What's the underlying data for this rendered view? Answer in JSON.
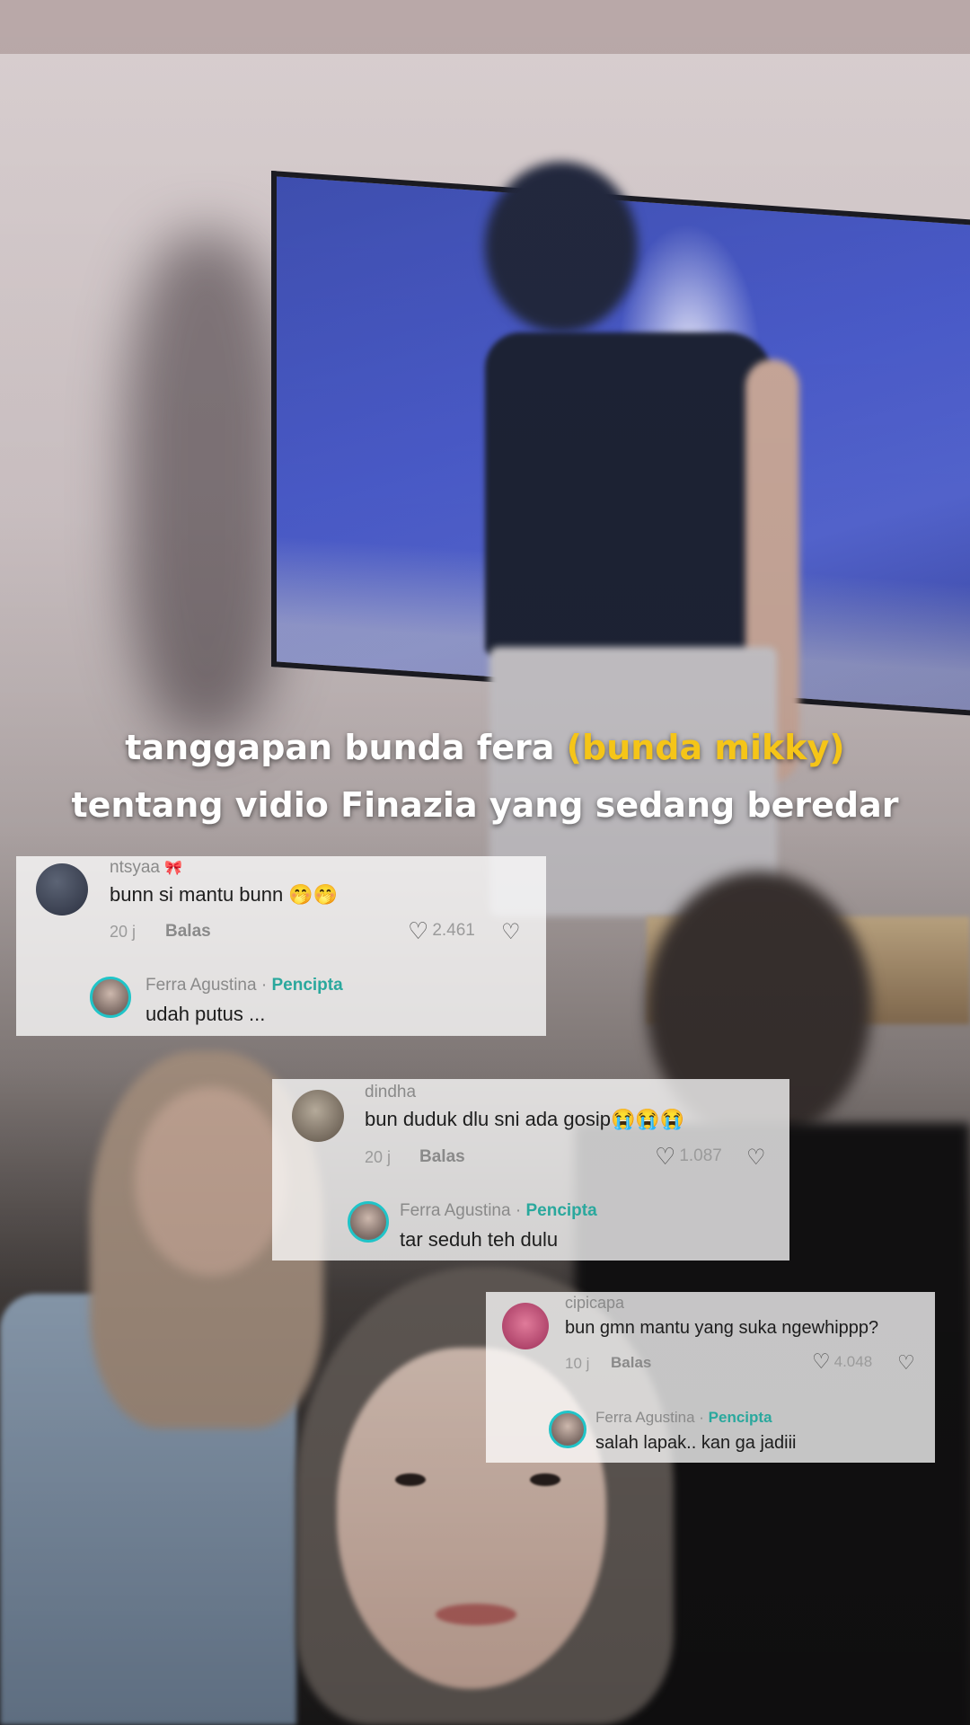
{
  "caption": {
    "line1_main": "tanggapan bunda fera ",
    "line1_highlight": "(bunda mikky)",
    "line2": "tentang vidio Finazia yang sedang beredar"
  },
  "colors": {
    "caption_text": "#ffffff",
    "caption_highlight": "#f5c518",
    "creator_tag": "#2aa89d",
    "reply_avatar_ring": "#20c4c8"
  },
  "comments": [
    {
      "username": "ntsyaa",
      "username_icon": "bow-icon",
      "text": "bunn si mantu bunn 🤭🤭",
      "time": "20 j",
      "reply_label": "Balas",
      "likes": "2.461",
      "reply": {
        "author": "Ferra Agustina",
        "separator": " · ",
        "badge": "Pencipta",
        "text": "udah putus ..."
      }
    },
    {
      "username": "dindha",
      "text": "bun duduk dlu sni ada gosip😭😭😭",
      "time": "20 j",
      "reply_label": "Balas",
      "likes": "1.087",
      "reply": {
        "author": "Ferra Agustina",
        "separator": " · ",
        "badge": "Pencipta",
        "text": "tar seduh teh dulu"
      }
    },
    {
      "username": "cipicapa",
      "text": "bun gmn mantu yang suka ngewhippp?",
      "time": "10 j",
      "reply_label": "Balas",
      "likes": "4.048",
      "reply": {
        "author": "Ferra Agustina",
        "separator": " · ",
        "badge": "Pencipta",
        "text": "salah lapak.. kan ga jadiii"
      }
    }
  ]
}
